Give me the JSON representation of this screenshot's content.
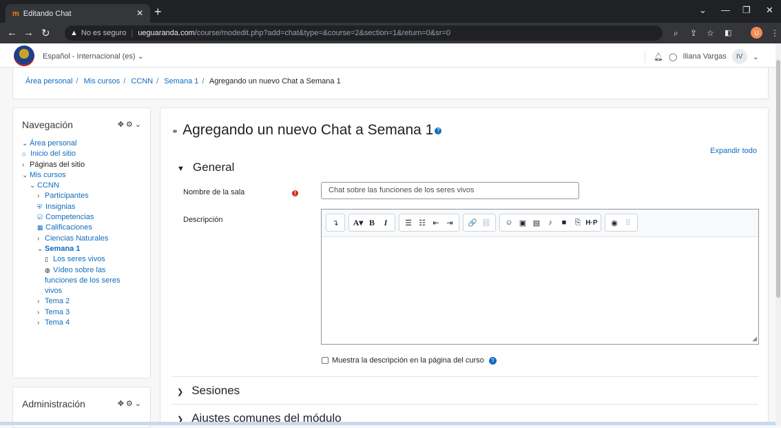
{
  "browser": {
    "tab_title": "Editando Chat",
    "tab_favicon": "m",
    "security_label": "No es seguro",
    "url_domain": "ueguaranda.com",
    "url_path": "/course/modedit.php?add=chat&type=&course=2&section=1&return=0&sr=0",
    "profile_initial": "U"
  },
  "header": {
    "language": "Español - Internacional (es)",
    "user_name": "Iliana Vargas",
    "user_initials": "IV"
  },
  "breadcrumb": [
    "Área personal",
    "Mis cursos",
    "CCNN",
    "Semana 1",
    "Agregando un nuevo Chat a Semana 1"
  ],
  "navigation": {
    "title": "Navegación",
    "items": [
      "Área personal",
      "Inicio del sitio",
      "Páginas del sitio",
      "Mis cursos",
      "CCNN",
      "Participantes",
      "Insignias",
      "Competencias",
      "Calificaciones",
      "Ciencias Naturales",
      "Semana 1",
      "Los seres vivos",
      "Vídeo sobre las",
      "funciones de los seres",
      "vivos",
      "Tema 2",
      "Tema 3",
      "Tema 4"
    ]
  },
  "administration": {
    "title": "Administración"
  },
  "main": {
    "page_title": "Agregando un nuevo Chat a Semana 1",
    "expand_all": "Expandir todo",
    "section_general": "General",
    "room_name_label": "Nombre de la sala",
    "room_name_value": "Chat sobre las funciones de los seres vivos",
    "description_label": "Descripción",
    "show_description_label": "Muestra la descripción en la página del curso",
    "section_sessions": "Sesiones",
    "section_common": "Ajustes comunes del módulo"
  },
  "editor_toolbar": {
    "groups": [
      [
        "↴"
      ],
      [
        "A▾",
        "B",
        "I"
      ],
      [
        "☰",
        "☷",
        "⇤",
        "⇥"
      ],
      [
        "🔗",
        "⛓"
      ],
      [
        "☺",
        "▣",
        "▤",
        "♪",
        "■",
        "⎘",
        "H·P"
      ],
      [
        "◉",
        "⠿"
      ]
    ]
  },
  "colors": {
    "link": "#0f6cbf",
    "required": "#ca3120",
    "chrome_dark": "#202124"
  }
}
